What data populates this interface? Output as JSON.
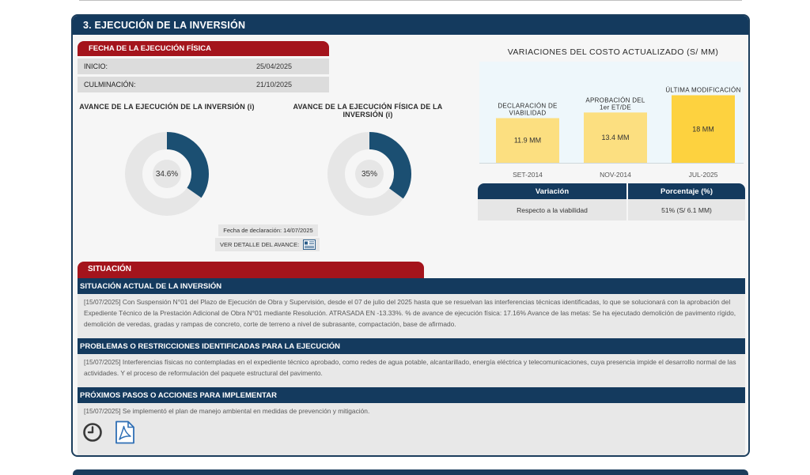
{
  "section": {
    "title": "3. EJECUCIÓN DE LA INVERSIÓN"
  },
  "fecha": {
    "title": "FECHA DE LA EJECUCIÓN FÍSICA",
    "rows": [
      {
        "label": "INICIO:",
        "value": "25/04/2025"
      },
      {
        "label": "CULMINACIÓN:",
        "value": "21/10/2025"
      }
    ]
  },
  "avance": {
    "inversion": {
      "title": "AVANCE DE LA EJECUCIÓN DE LA INVERSIÓN (i)",
      "value_text": "34.6%",
      "fraction": 0.346
    },
    "fisica": {
      "title": "AVANCE DE LA EJECUCIÓN FÍSICA DE LA INVERSIÓN (i)",
      "value_text": "35%",
      "fraction": 0.35
    },
    "fecha_declaracion": "Fecha de declaración: 14/07/2025",
    "ver_detalle": "VER DETALLE DEL AVANCE:"
  },
  "chart_data": {
    "type": "bar",
    "title": "VARIACIONES DEL COSTO ACTUALIZADO (S/ MM)",
    "categories": [
      "SET-2014",
      "NOV-2014",
      "JUL-2025"
    ],
    "bar_labels": [
      "DECLARACIÓN DE VIABILIDAD",
      "APROBACIÓN DEL 1er ET/DE",
      "ÚLTIMA MODIFICACIÓN"
    ],
    "data_labels": [
      "11.9 MM",
      "13.4 MM",
      "18 MM"
    ],
    "values": [
      11.9,
      13.4,
      18
    ],
    "ylim": [
      0,
      20
    ],
    "colors": [
      "#fcdf80",
      "#fcdf80",
      "#fdd23f"
    ]
  },
  "variacion": {
    "headers": [
      "Variación",
      "Porcentaje (%)"
    ],
    "rows": [
      [
        "Respecto a la viabilidad",
        "51% (S/ 6.1 MM)"
      ]
    ]
  },
  "situacion": {
    "tab": "SITUACIÓN",
    "actual": {
      "title": "SITUACIÓN ACTUAL DE LA INVERSIÓN",
      "text": "[15/07/2025] Con Suspensión N°01 del Plazo de Ejecución de Obra y Supervisión, desde el 07 de julio del 2025 hasta que se resuelvan las interferencias técnicas identificadas, lo que se solucionará con la aprobación del Expediente Técnico de la Prestación Adicional de Obra N°01 mediante Resolución. ATRASADA EN -13.33%. % de avance de ejecución física: 17.16% Avance de las metas: Se ha ejecutado demolición de pavimento rígido, demolición de veredas, gradas y rampas de concreto, corte de terreno a nivel de subrasante, compactación, base de afirmado."
    },
    "problemas": {
      "title": "PROBLEMAS O RESTRICCIONES IDENTIFICADAS PARA LA EJECUCIÓN",
      "text": "[15/07/2025] Interferencias físicas no contempladas en el expediente técnico aprobado, como redes de agua potable, alcantarillado, energía eléctrica y telecomunicaciones, cuya presencia impide el desarrollo normal de las actividades. Y el proceso de reformulación del paquete estructural del pavimento."
    },
    "pasos": {
      "title": "PRÓXIMOS PASOS O ACCIONES PARA IMPLEMENTAR",
      "text": "[15/07/2025] Se implementó el plan de manejo ambiental en medidas de prevención y mitigación."
    }
  },
  "colors": {
    "navy": "#143a5e",
    "red": "#a4141c",
    "donut_fill": "#1b4f72",
    "donut_track": "#e6e6e6"
  },
  "icons": [
    "clock-icon",
    "pdf-icon",
    "document-icon"
  ]
}
